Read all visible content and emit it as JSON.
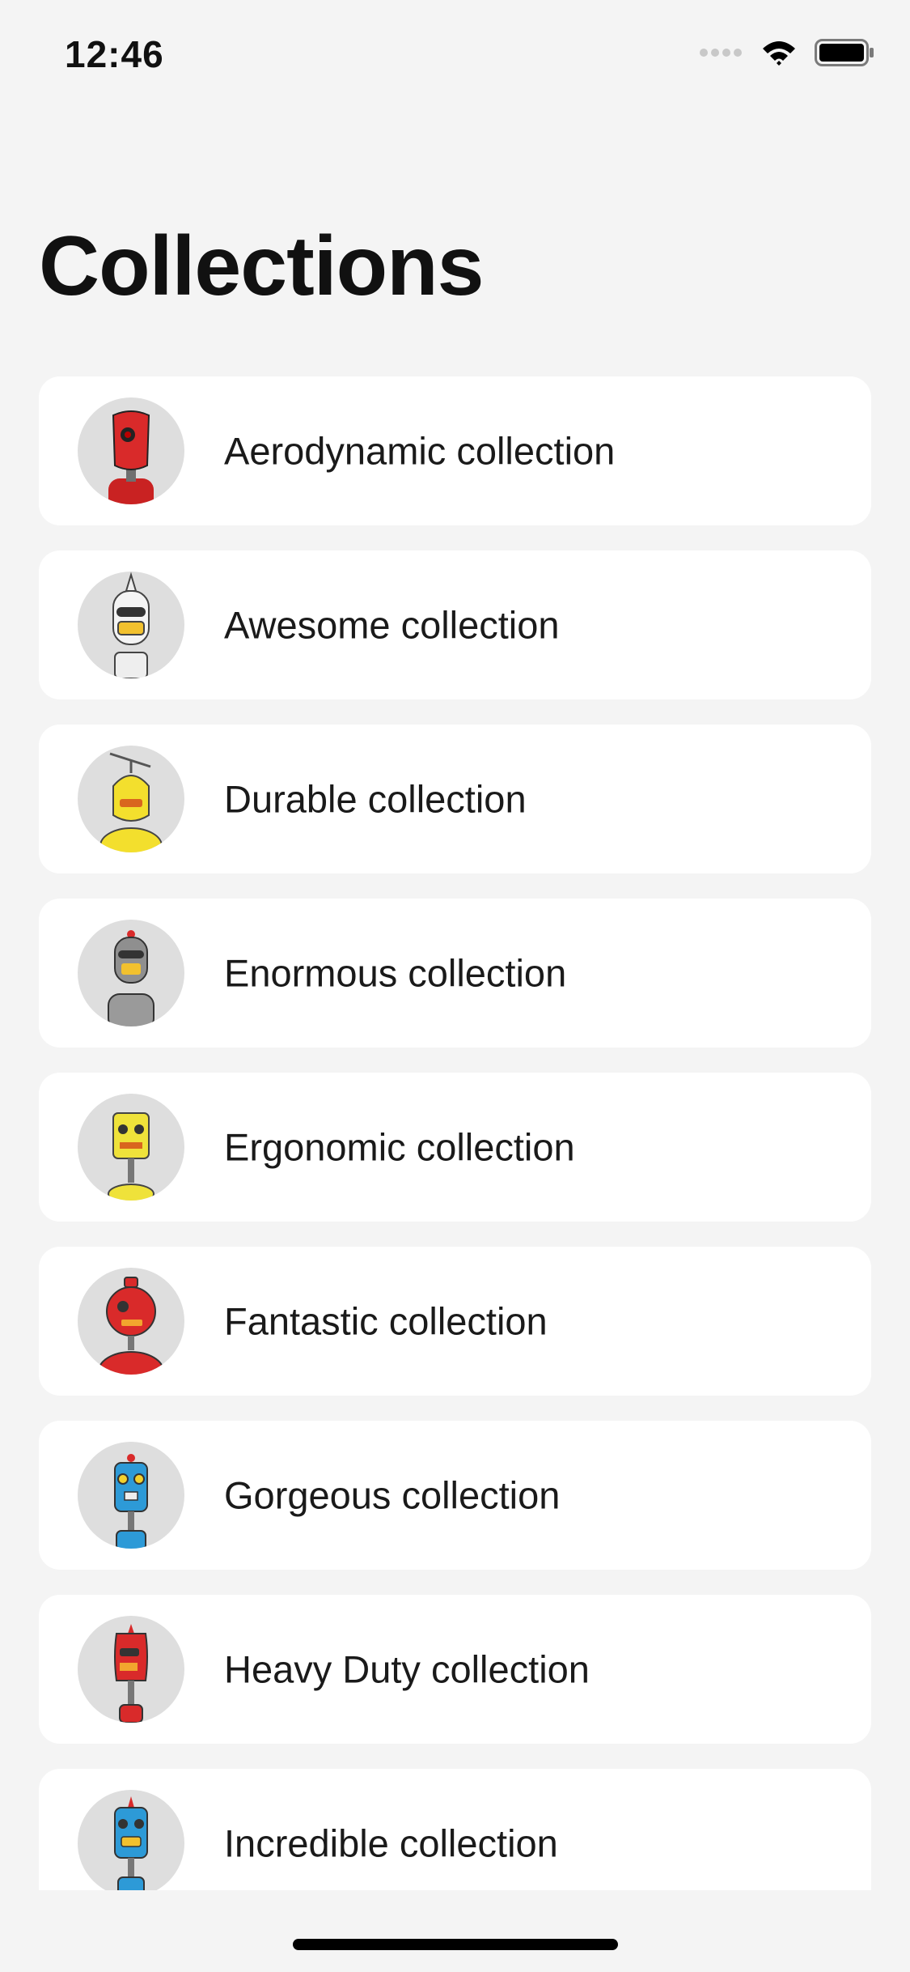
{
  "status_bar": {
    "time": "12:46",
    "icons": [
      "signal-icon",
      "wifi-icon",
      "battery-icon"
    ]
  },
  "page": {
    "title": "Collections"
  },
  "collections": [
    {
      "label": "Aerodynamic collection",
      "avatar_icon": "red-robot-avatar-icon",
      "avatar_color": "#d92a2a"
    },
    {
      "label": "Awesome collection",
      "avatar_icon": "white-robot-avatar-icon",
      "avatar_color": "#f2f2f2"
    },
    {
      "label": "Durable collection",
      "avatar_icon": "yellow-robot-avatar-icon",
      "avatar_color": "#f3df2d"
    },
    {
      "label": "Enormous collection",
      "avatar_icon": "gray-robot-avatar-icon",
      "avatar_color": "#8f8f8f"
    },
    {
      "label": "Ergonomic collection",
      "avatar_icon": "yellow-robot-avatar-icon",
      "avatar_color": "#efe23a"
    },
    {
      "label": "Fantastic collection",
      "avatar_icon": "red-robot-avatar-icon",
      "avatar_color": "#d92a2a"
    },
    {
      "label": "Gorgeous collection",
      "avatar_icon": "blue-robot-avatar-icon",
      "avatar_color": "#2d9ad7"
    },
    {
      "label": "Heavy Duty collection",
      "avatar_icon": "red-robot-avatar-icon",
      "avatar_color": "#d92a2a"
    },
    {
      "label": "Incredible collection",
      "avatar_icon": "blue-robot-avatar-icon",
      "avatar_color": "#2d9ad7"
    }
  ]
}
